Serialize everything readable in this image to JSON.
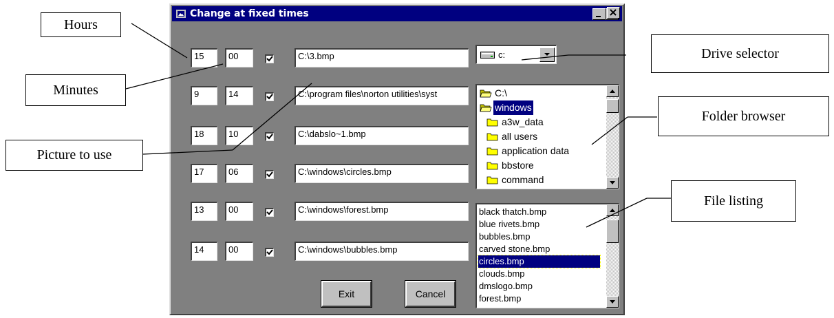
{
  "window": {
    "title": "Change at fixed times",
    "controls": [
      "minimize-icon",
      "maximize-icon",
      "close-icon"
    ]
  },
  "schedule": [
    {
      "hours": "15",
      "minutes": "00",
      "enabled": true,
      "picture": "C:\\3.bmp"
    },
    {
      "hours": "9",
      "minutes": "14",
      "enabled": true,
      "picture": "C:\\program files\\norton utilities\\syst"
    },
    {
      "hours": "18",
      "minutes": "10",
      "enabled": true,
      "picture": "C:\\dabslo~1.bmp"
    },
    {
      "hours": "17",
      "minutes": "06",
      "enabled": true,
      "picture": "C:\\windows\\circles.bmp"
    },
    {
      "hours": "13",
      "minutes": "00",
      "enabled": true,
      "picture": "C:\\windows\\forest.bmp"
    },
    {
      "hours": "14",
      "minutes": "00",
      "enabled": true,
      "picture": "C:\\windows\\bubbles.bmp"
    }
  ],
  "drive": {
    "value": "c:",
    "icon": "drive-icon"
  },
  "folders": {
    "items": [
      {
        "label": "C:\\",
        "icon": "open-folder-icon",
        "selected": false
      },
      {
        "label": "windows",
        "icon": "open-folder-icon",
        "selected": true
      },
      {
        "label": "a3w_data",
        "icon": "folder-icon",
        "selected": false
      },
      {
        "label": "all users",
        "icon": "folder-icon",
        "selected": false
      },
      {
        "label": "application data",
        "icon": "folder-icon",
        "selected": false
      },
      {
        "label": "bbstore",
        "icon": "folder-icon",
        "selected": false
      },
      {
        "label": "command",
        "icon": "folder-icon",
        "selected": false
      }
    ]
  },
  "files": {
    "items": [
      "black thatch.bmp",
      "blue rivets.bmp",
      "bubbles.bmp",
      "carved stone.bmp",
      "circles.bmp",
      "clouds.bmp",
      "dmslogo.bmp",
      "forest.bmp"
    ],
    "selected": "circles.bmp"
  },
  "buttons": {
    "exit": "Exit",
    "cancel": "Cancel"
  },
  "callouts": {
    "hours": "Hours",
    "minutes": "Minutes",
    "picture": "Picture to use",
    "drive": "Drive selector",
    "folder": "Folder browser",
    "files": "File listing"
  },
  "colors": {
    "face": "#808080",
    "titlebar": "#000080",
    "selection": "#000080"
  }
}
